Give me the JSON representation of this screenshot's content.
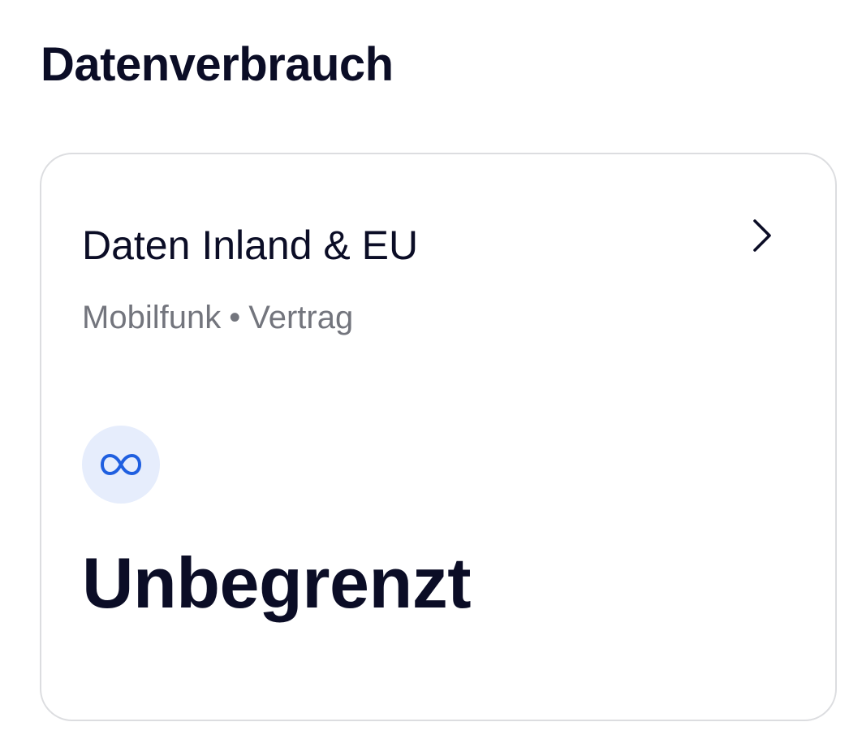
{
  "section": {
    "title": "Datenverbrauch"
  },
  "card": {
    "title": "Daten Inland & EU",
    "subtitle_type": "Mobilfunk",
    "subtitle_separator": "•",
    "subtitle_contract": "Vertrag",
    "usage_value": "Unbegrenzt",
    "icons": {
      "badge": "infinity-icon",
      "navigate": "chevron-right-icon"
    },
    "colors": {
      "infinity_icon": "#1f5fe0",
      "badge_background": "#e6edfc",
      "primary_text": "#0b0d26",
      "secondary_text": "#73757d"
    }
  }
}
